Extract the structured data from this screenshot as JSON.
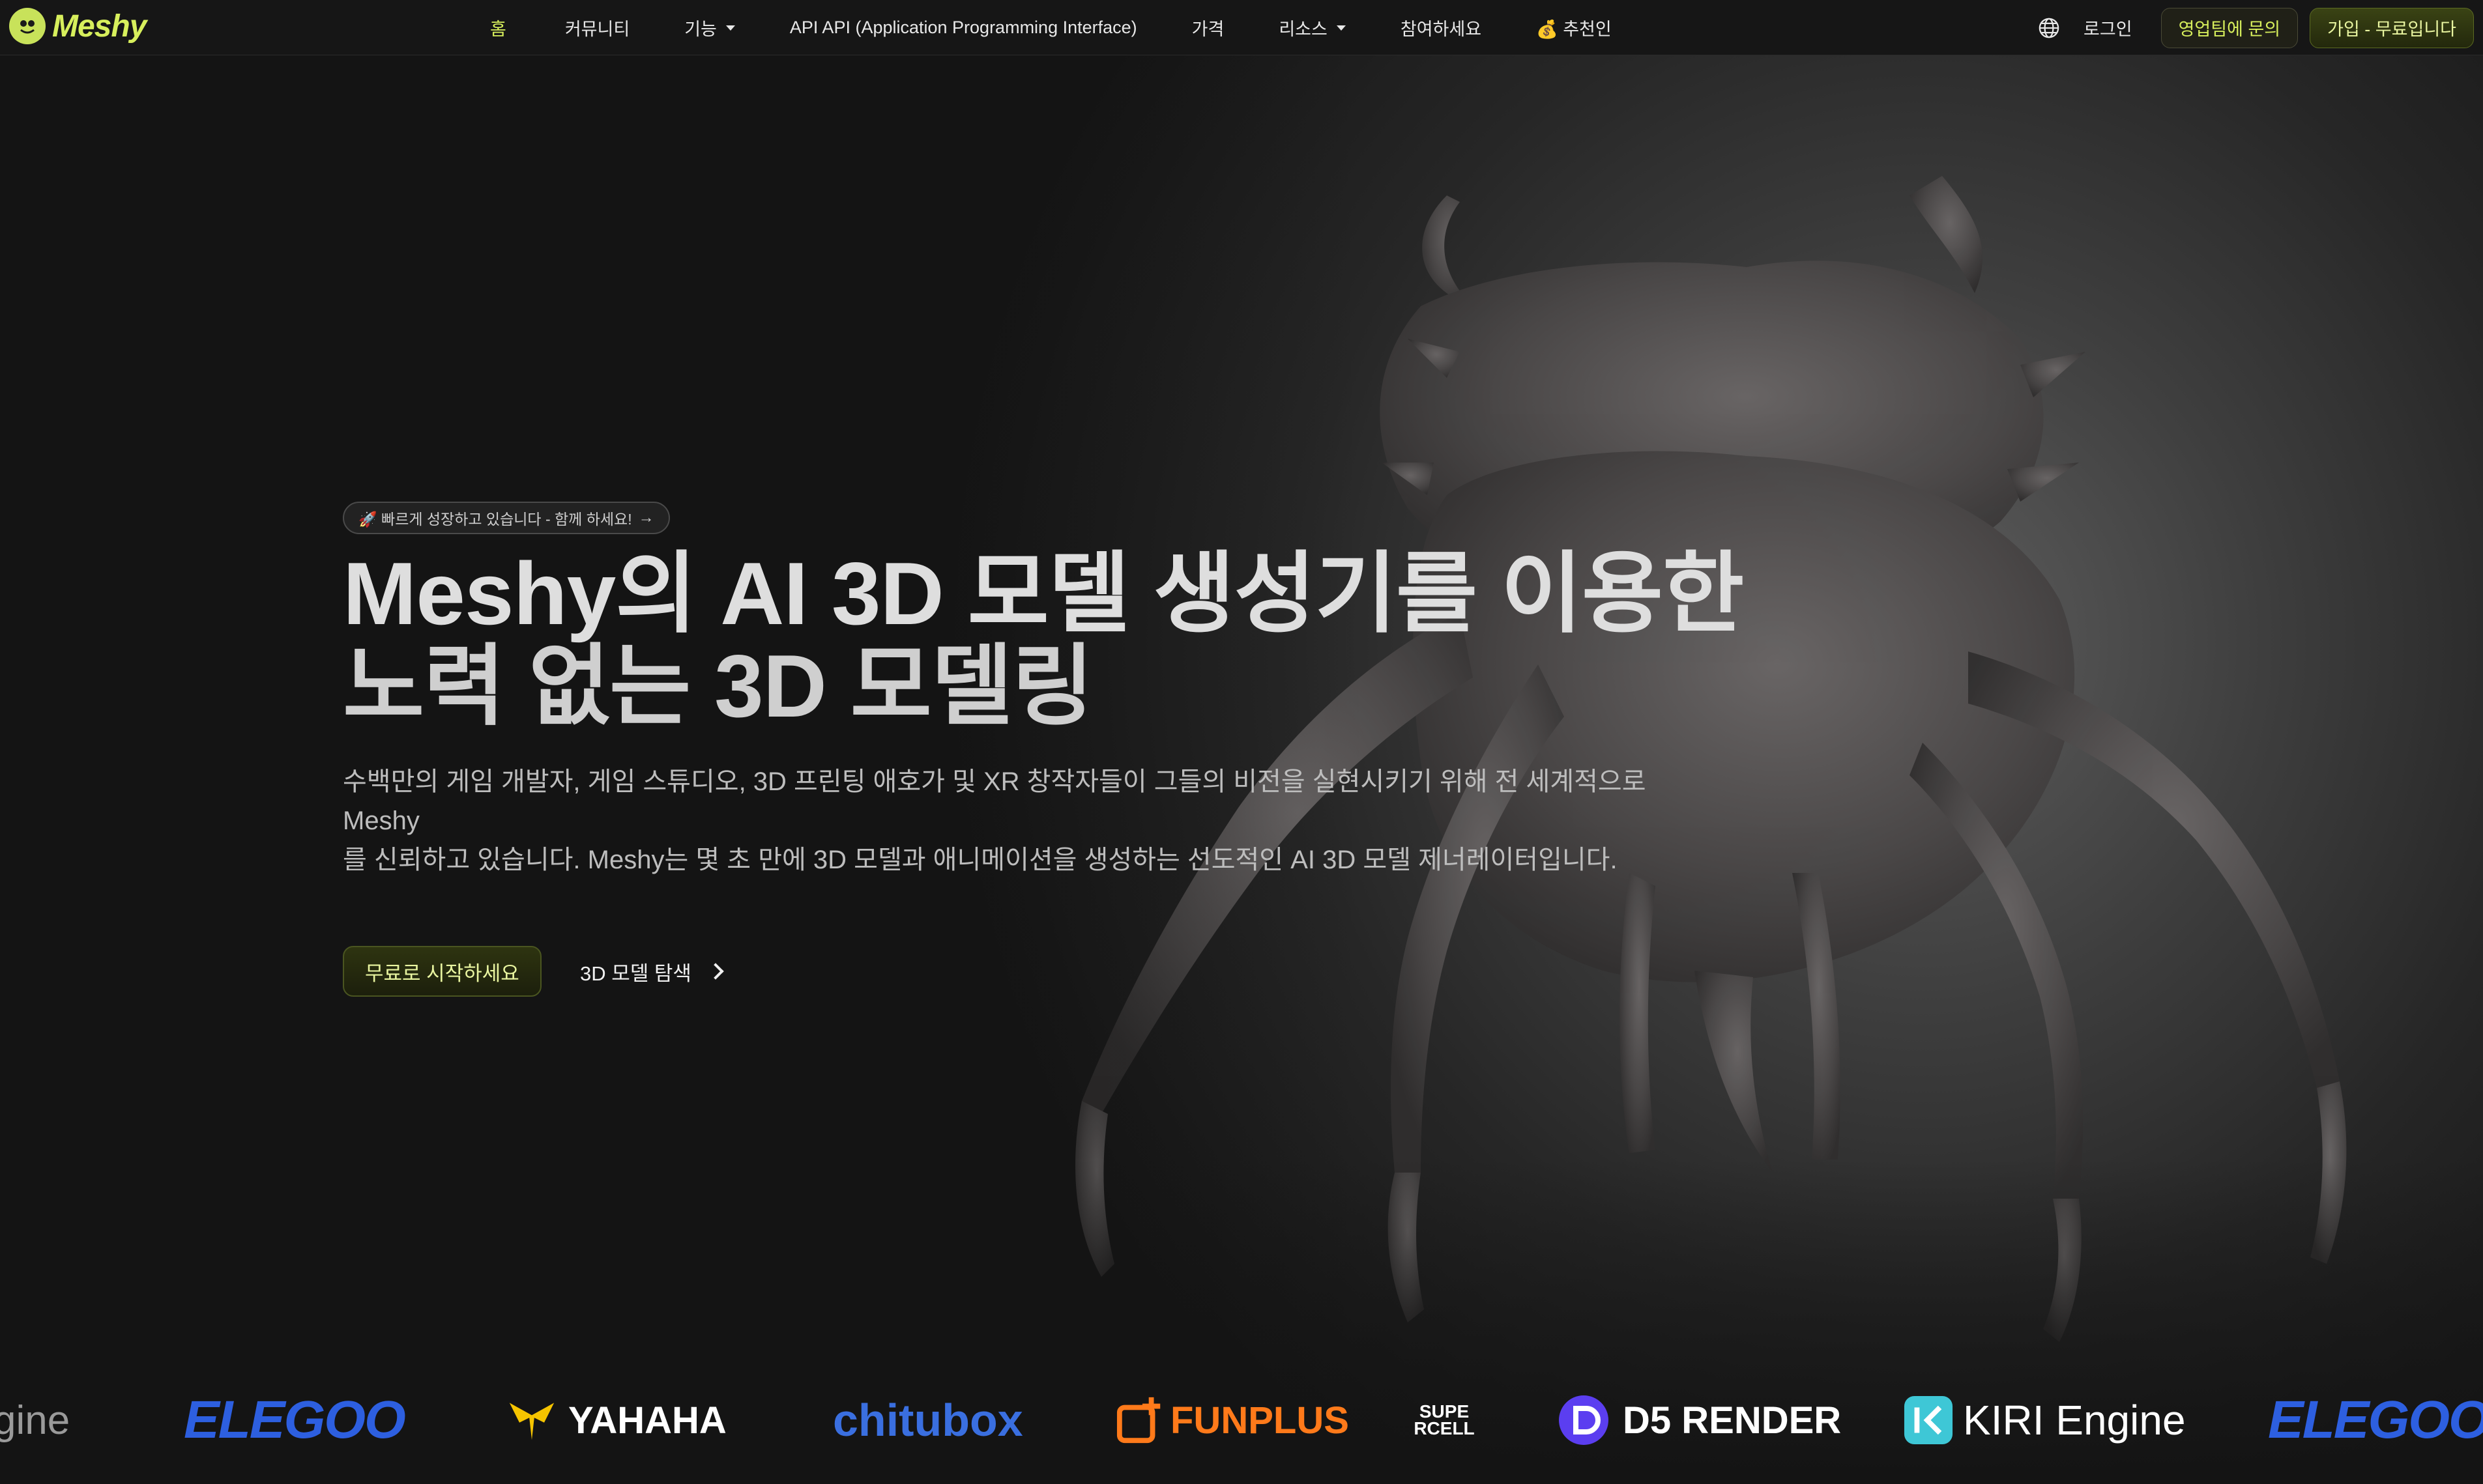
{
  "nav": {
    "logo_text": "Meshy",
    "items": [
      {
        "label": "홈",
        "active": true,
        "dropdown": false
      },
      {
        "label": "커뮤니티",
        "active": false,
        "dropdown": false
      },
      {
        "label": "기능",
        "active": false,
        "dropdown": true
      },
      {
        "label": "API API (Application Programming Interface)",
        "active": false,
        "dropdown": false
      },
      {
        "label": "가격",
        "active": false,
        "dropdown": false
      },
      {
        "label": "리소스",
        "active": false,
        "dropdown": true
      },
      {
        "label": "참여하세요",
        "active": false,
        "dropdown": false
      },
      {
        "label": "💰 추천인",
        "active": false,
        "dropdown": false
      }
    ],
    "login": "로그인",
    "contact_sales": "영업팀에 문의",
    "signup": "가입 - 무료입니다"
  },
  "hero": {
    "badge": "🚀 빠르게 성장하고 있습니다 - 함께 하세요!",
    "title_line1": "Meshy의 AI 3D 모델 생성기를 이용한",
    "title_line2": "노력 없는 3D 모델링",
    "subtitle_line1": "수백만의 게임 개발자, 게임 스튜디오, 3D 프린팅 애호가 및 XR 창작자들이 그들의 비전을 실현시키기 위해 전 세계적으로 Meshy",
    "subtitle_line2": "를 신뢰하고 있습니다. Meshy는 몇 초 만에 3D 모델과 애니메이션을 생성하는 선도적인 AI 3D 모델 제너레이터입니다.",
    "cta_primary": "무료로 시작하세요",
    "cta_secondary": "3D 모델 탐색"
  },
  "partners": [
    {
      "name": "gine",
      "color": "#9a9a9a"
    },
    {
      "name": "ELEGOO",
      "color": "#2d5fe0"
    },
    {
      "name": "YAHAHA",
      "color": "#ffffff"
    },
    {
      "name": "chitubox",
      "color": "#3a6fe0"
    },
    {
      "name": "FUNPLUS",
      "color": "#ff7a1a"
    },
    {
      "name": "SUPERCELL",
      "color": "#ffffff"
    },
    {
      "name": "D5 RENDER",
      "color": "#ffffff"
    },
    {
      "name": "KIRI Engine",
      "color": "#ffffff"
    },
    {
      "name": "ELEGOO",
      "color": "#2d5fe0"
    }
  ],
  "icons": [
    "meshy-logo-icon",
    "globe-icon",
    "chevron-down-icon",
    "arrow-right-icon",
    "chevron-right-icon"
  ]
}
